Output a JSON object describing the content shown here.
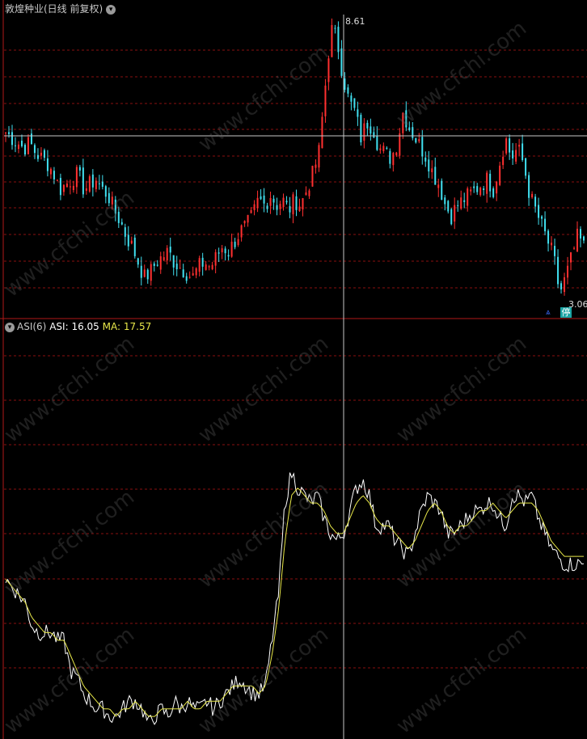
{
  "header": {
    "title": "敦煌种业(日线 前复权)",
    "dropdown_icon": "chevron-down-icon"
  },
  "indicator": {
    "name": "ASI(6)",
    "asi_label": "ASI:",
    "asi_value": "16.05",
    "ma_label": "MA:",
    "ma_value": "17.57",
    "dropdown_icon": "chevron-down-icon"
  },
  "annotations": {
    "high_label": "8.61",
    "low_label": "3.06",
    "limit_badge": "停"
  },
  "watermark": "www.cfchi.com",
  "colors": {
    "up": "#ff3030",
    "down": "#40e0f0",
    "asi": "#ffffff",
    "ma": "#e8e84a",
    "grid": "#8a1010",
    "crosshair": "#c8c8c8"
  },
  "chart_data": [
    {
      "type": "candlestick",
      "title": "敦煌种业(日线 前复权)",
      "ylim": [
        3.06,
        8.61
      ],
      "close_path": [
        6.4,
        6.3,
        6.2,
        6.1,
        6.2,
        6.0,
        5.9,
        5.8,
        5.6,
        5.3,
        5.4,
        5.5,
        5.6,
        5.3,
        5.4,
        5.5,
        5.3,
        5.2,
        4.9,
        4.7,
        4.4,
        4.2,
        3.9,
        3.6,
        3.7,
        3.9,
        4.0,
        4.1,
        3.9,
        3.8,
        3.7,
        3.6,
        3.8,
        3.9,
        3.8,
        4.0,
        4.2,
        4.1,
        4.3,
        4.5,
        4.6,
        4.8,
        5.1,
        5.0,
        5.2,
        5.0,
        5.1,
        4.9,
        5.1,
        5.0,
        5.3,
        5.6,
        6.0,
        7.2,
        8.4,
        8.2,
        7.5,
        7.0,
        6.8,
        6.3,
        6.6,
        6.5,
        6.1,
        6.0,
        5.9,
        6.2,
        6.8,
        6.5,
        6.3,
        6.1,
        5.9,
        5.6,
        5.4,
        5.0,
        4.8,
        5.0,
        5.1,
        5.2,
        5.3,
        5.4,
        5.5,
        5.3,
        5.8,
        6.3,
        5.9,
        6.1,
        5.8,
        5.2,
        4.9,
        4.6,
        4.3,
        4.0,
        3.3,
        3.6,
        4.0,
        4.4,
        4.2
      ]
    },
    {
      "type": "line",
      "series": [
        {
          "name": "ASI",
          "values": [
            14,
            13,
            12,
            11,
            8,
            7,
            7,
            7,
            6,
            6,
            2,
            1,
            -1,
            -2,
            -3,
            -3,
            -4,
            -4,
            -3,
            -2,
            -2,
            -3,
            -5,
            -4,
            -3,
            -4,
            -2,
            -3,
            -2,
            -3,
            -3,
            -2,
            -3,
            -2,
            -1,
            0,
            1,
            0,
            -1,
            -1,
            0,
            6,
            12,
            24,
            28,
            26,
            25,
            24,
            25,
            22,
            20,
            19,
            20,
            23,
            26,
            27,
            25,
            21,
            21,
            21,
            19,
            18,
            17,
            20,
            23,
            25,
            24,
            23,
            20,
            20,
            21,
            22,
            23,
            23,
            24,
            24,
            22,
            21,
            25,
            25,
            24,
            25,
            22,
            20,
            18,
            17,
            16,
            16,
            16,
            16
          ]
        },
        {
          "name": "MA",
          "values": [
            14,
            13,
            12,
            11,
            9,
            8,
            7,
            7,
            6,
            6,
            4,
            2,
            0,
            -1,
            -2,
            -3,
            -3,
            -4,
            -3,
            -3,
            -2,
            -3,
            -4,
            -4,
            -3,
            -3,
            -3,
            -3,
            -2,
            -3,
            -3,
            -2,
            -2,
            -2,
            -1,
            0,
            0,
            0,
            0,
            -1,
            0,
            4,
            10,
            19,
            25,
            26,
            25,
            24,
            24,
            23,
            21,
            20,
            20,
            22,
            24,
            25,
            24,
            22,
            21,
            21,
            20,
            19,
            18,
            19,
            21,
            23,
            24,
            23,
            21,
            20,
            21,
            21,
            22,
            23,
            23,
            24,
            23,
            22,
            23,
            24,
            24,
            24,
            23,
            21,
            19,
            18,
            17,
            17,
            17,
            17
          ]
        }
      ],
      "legend": "top-left"
    }
  ]
}
